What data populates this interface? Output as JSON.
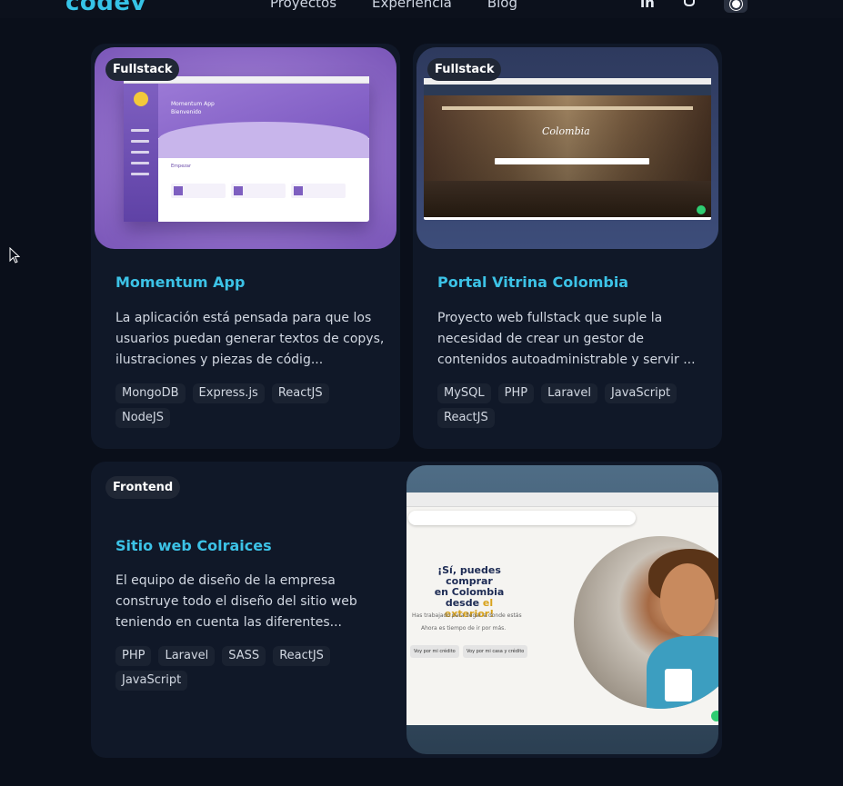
{
  "header": {
    "logo": "codev",
    "nav": [
      "Proyectos",
      "Experiencia",
      "Blog"
    ],
    "linkedin_label": "in",
    "github_icon": "github-icon",
    "theme_icon": "sun-icon"
  },
  "projects": [
    {
      "category": "Fullstack",
      "title": "Momentum App",
      "description": "La aplicación está pensada para que los usuarios puedan generar textos de copys, ilustraciones y piezas de códig...",
      "tags": [
        "MongoDB",
        "Express.js",
        "ReactJS",
        "NodeJS"
      ],
      "preview": {
        "heading": "Momentum App",
        "subheading": "Bienvenido",
        "section": "Empezar"
      }
    },
    {
      "category": "Fullstack",
      "title": "Portal Vitrina Colombia",
      "description": "Proyecto web fullstack que suple la necesidad de crear un gestor de contenidos autoadministrable y servir ...",
      "tags": [
        "MySQL",
        "PHP",
        "Laravel",
        "JavaScript",
        "ReactJS"
      ],
      "preview": {
        "brand": "Colombia"
      }
    },
    {
      "category": "Frontend",
      "title": "Sitio web Colraices",
      "description": "El equipo de diseño de la empresa construye todo el diseño del sitio web teniendo en cuenta las diferentes...",
      "tags": [
        "PHP",
        "Laravel",
        "SASS",
        "ReactJS",
        "JavaScript"
      ],
      "preview": {
        "headline_1": "¡Sí, puedes comprar",
        "headline_2": "en Colombia",
        "headline_3": "desde",
        "headline_gold": "el exterior!",
        "sub_1": "Has trabajado para llegar a donde estás",
        "sub_2": "Ahora es tiempo de ir por más.",
        "btn_1": "Voy por mi crédito",
        "btn_2": "Voy por mi casa y crédito"
      }
    }
  ],
  "colors": {
    "background": "#0a0f1a",
    "card": "#101828",
    "accent": "#3cc2e6",
    "tag_bg": "#1a2231"
  }
}
